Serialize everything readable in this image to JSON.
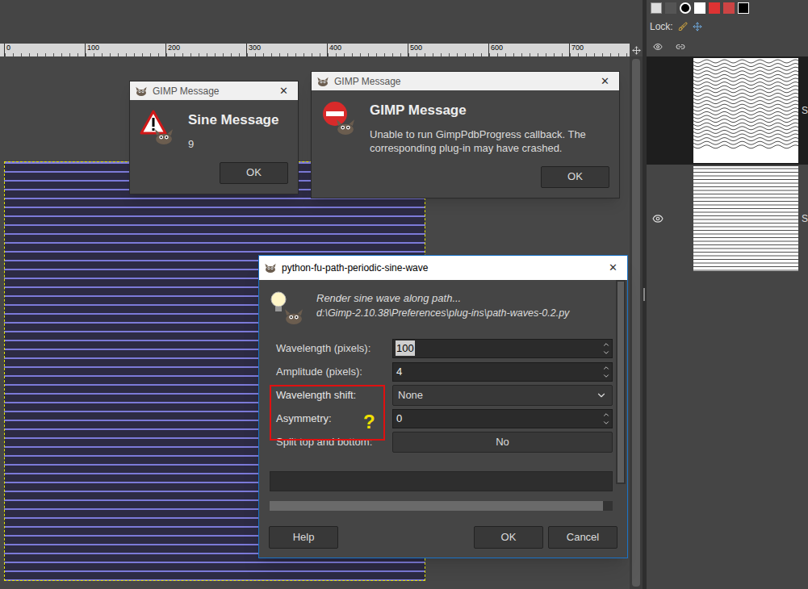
{
  "ruler": {
    "ticks": [
      "0",
      "100",
      "200",
      "300",
      "400",
      "500",
      "600",
      "700"
    ]
  },
  "layers_panel": {
    "lock_label": "Lock:",
    "layers": [
      {
        "name": "S",
        "visible": false,
        "selected": true,
        "kind": "waves"
      },
      {
        "name": "S",
        "visible": true,
        "selected": false,
        "kind": "lines"
      }
    ]
  },
  "messages": [
    {
      "title": "GIMP Message",
      "heading": "Sine Message",
      "body": "9",
      "kind": "warning",
      "button": "OK"
    },
    {
      "title": "GIMP Message",
      "heading": "GIMP Message",
      "body": "Unable to run GimpPdbProgress callback. The corresponding plug-in may have crashed.",
      "kind": "error",
      "button": "OK"
    }
  ],
  "plugin_dialog": {
    "title": "python-fu-path-periodic-sine-wave",
    "description": "Render sine wave along path...",
    "path": "d:\\Gimp-2.10.38\\Preferences\\plug-ins\\path-waves-0.2.py",
    "fields": [
      {
        "label": "Wavelength (pixels):",
        "kind": "spin",
        "value": "100",
        "selected": true,
        "highlighted": false
      },
      {
        "label": "Amplitude (pixels):",
        "kind": "spin",
        "value": "4",
        "selected": false,
        "highlighted": false
      },
      {
        "label": "Wavelength shift:",
        "kind": "combo",
        "value": "None",
        "selected": false,
        "highlighted": true
      },
      {
        "label": "Asymmetry:",
        "kind": "spin",
        "value": "0",
        "selected": false,
        "highlighted": true
      },
      {
        "label": "Split top and bottom:",
        "kind": "toggle",
        "value": "No",
        "selected": false,
        "highlighted": false
      }
    ],
    "annotation": "?",
    "progress": {
      "level": 0
    },
    "buttons": [
      "Help",
      "OK",
      "Cancel"
    ]
  },
  "close_glyph": "✕"
}
